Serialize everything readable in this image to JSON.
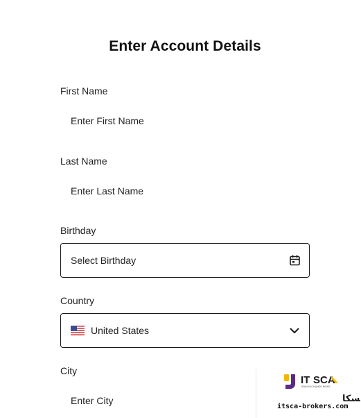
{
  "form": {
    "title": "Enter Account Details",
    "first_name": {
      "label": "First Name",
      "placeholder": "Enter First Name",
      "value": ""
    },
    "last_name": {
      "label": "Last Name",
      "placeholder": "Enter Last Name",
      "value": ""
    },
    "birthday": {
      "label": "Birthday",
      "placeholder": "Select Birthday",
      "icon": "calendar-icon"
    },
    "country": {
      "label": "Country",
      "selected": "United States",
      "flag_icon": "us-flag-icon",
      "icon": "chevron-down-icon"
    },
    "city": {
      "label": "City",
      "placeholder": "Enter City",
      "value": ""
    }
  },
  "watermark": {
    "logo_text": "ITSCA",
    "tagline": "IRAN EXCHANGE NEWS",
    "persian_text": "وبسایت ایتسکا",
    "domain": "itsca-brokers.com",
    "colors": {
      "brand_yellow": "#f2b705",
      "brand_purple": "#5b2a86"
    }
  }
}
